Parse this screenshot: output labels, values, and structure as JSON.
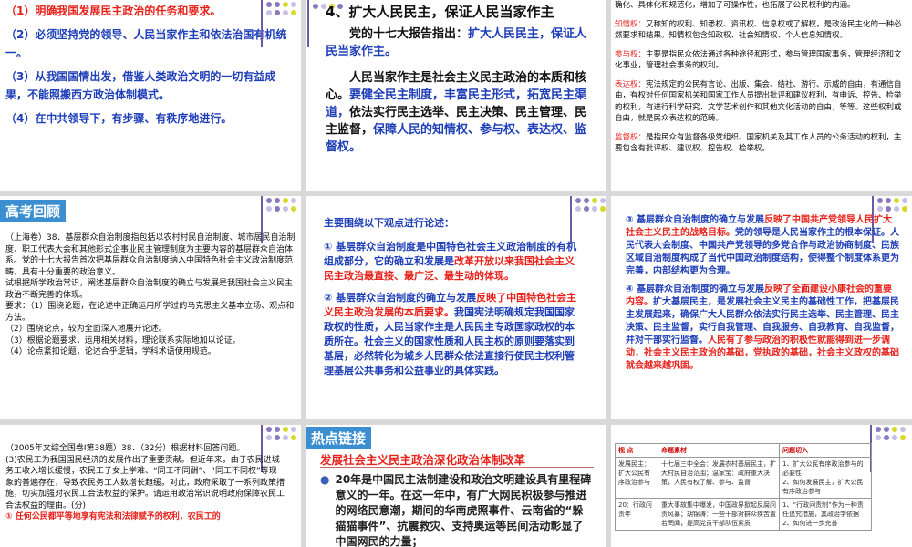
{
  "s1": {
    "items": [
      "（1）明确我国发展民主政治的任务和要求。",
      "（2）必须坚持党的领导、人民当家作主和依法治国有机统一。",
      "（3）从我国国情出发，借鉴人类政治文明的一切有益成果，不能照搬西方政治体制模式。",
      "（4）在中共领导下，有步骤、有秩序地进行。"
    ]
  },
  "s2": {
    "title": "4、扩大人民民主，保证人民当家作主",
    "p1_a": "党的十七大报告指出：",
    "p1_b": "扩大人民民主，保证人民当家作主。",
    "p2_a": "人民当家作主是社会主义民主政治的本质和核心。",
    "p2_b": "要健全民主制度，丰富民主形式，拓宽民主渠道，",
    "p2_c": "依法实行民主选举、民主决策、民主管理、民主监督，",
    "p2_d": "保障人民的知情权、参与权、表达权、监督权。"
  },
  "s3": {
    "intro": "确化、具体化和规范化，增加了可操作性，也拓展了公民权利的内涵。",
    "items": [
      {
        "term": "知情权：",
        "text": "又称知的权利、知悉权、资讯权、信息权或了解权，是政治民主化的一种必然要求和结果。知情权包含知政权、社会知情权、个人信息知情权。"
      },
      {
        "term": "参与权：",
        "text": "主要是指民众依法通过各种途径和形式，参与管理国家事务，管理经济和文化事业，管理社会事务的权利。"
      },
      {
        "term": "表达权：",
        "text": "宪法规定的公民有言论、出版、集会、结社、游行、示威的自由，有通信自由，有权对任何国家机关和国家工作人员提出批评和建议权利，有申诉、控告、检举的权利，有进行科学研究、文学艺术创作和其他文化活动的自由，等等。这些权利或自由，就是民众表达权的范畴。"
      },
      {
        "term": "监督权：",
        "text": "是指民众有监督各级党组织、国家机关及其工作人员的公务活动的权利，主要包含有批评权、建议权、控告权、检举权。"
      }
    ]
  },
  "s4": {
    "tag": "高考回顾",
    "body": "（上海卷）38．基层群众自治制度指包括以农村村民自治制度、城市居民自治制度、职工代表大会和其他形式企事业民主管理制度为主要内容的基层群众自治体系。党的十七大报告首次把基层群众自治制度纳入中国特色社会主义政治制度范畴，具有十分重要的政治意义。",
    "task": "试根据所学政治常识，阐述基层群众自治制度的确立与发展是我国社会主义民主政治不断完善的体现。",
    "req": [
      "要求：（1）围绕论题，在论述中正确运用所学过的马克思主义基本立场、观点和方法。",
      "（2）围绕论点，较为全面深入地展开论述。",
      "（3）根据论题要求，运用相关材料，理论联系实际地加以论证。",
      "（4）论点紧扣论题，论述合乎逻辑，学科术语使用规范。"
    ]
  },
  "s5": {
    "heading": "主要围绕以下观点进行论述：",
    "p1_a": "① 基层群众自治制度是中国特色社会主义政治制度的有机组成部分，它的确立和发展是",
    "p1_b": "改革开放以来我国社会主义民主政治最直接、最广泛、最生动的体现。",
    "p2_a": "② 基层群众自治制度的确立与发展",
    "p2_b": "反映了中国特色社会主义民主政治发展的本质要求。",
    "p2_c": "我国宪法明确规定我国国家政权的性质，人民当家作主是人民民主专政国家政权的本质所在。社会主义的国家性质和人民主权的原则要落实到基层，必然转化为城乡人民群众依法直接行使民主权利管理基层公共事务和公益事业的具体实践。"
  },
  "s6": {
    "p3_a": "③ 基层群众自治制度的确立与发展",
    "p3_b": "反映了中国共产党领导人民扩大社会主义民主的战略目标。",
    "p3_c": "党的领导是人民当家作主的根本保证。人民代表大会制度、中国共产党领导的多党合作与政治协商制度、民族区域自治制度构成了当代中国政治制度结构，使得整个制度体系更为完善，内部结构更为合理。",
    "p4_a": "④ 基层群众自治制度的确立与发展",
    "p4_b": "反映了全面建设小康社会的重要内容。",
    "p4_c": "扩大基层民主，是发展社会主义民主的基础性工作，把基层民主发展起来，确保广大人民群众依法实行民主选举、民主管理、民主决策、民主监督，实行自我管理、自我服务、自我教育、自我监督，并对干部实行监督。",
    "p4_d": "人民有了参与政治的积极性就能得到进一步调动，社会主义民主政治的基础，党执政的基础，社会主义政权的基础就会越来越巩固。"
  },
  "s7": {
    "head": "（2005年文综全国卷Ⅰ第38题）38．（32分）根据材料回答问题。",
    "body": "(3)农民工为我国国民经济的发展作出了重要贡献。但近年来，由于农民进城务工收入增长缓慢，农民工子女上学难、“同工不同酬”、“同工不同权”等现象的普遍存在，导致农民务工人数增长趋缓。对此，政府采取了一系列政策措施，切实加强对农民工合法权益的保护。请运用政治常识说明政府保障农民工合法权益的理由。(分)",
    "ans": "① 任何公民都平等地享有宪法和法律赋予的权利，农民工的"
  },
  "s8": {
    "tag": "热点链接",
    "subtitle": "发展社会主义民主政治深化政治体制改革",
    "bullet": "●",
    "body": "20年是中国民主法制建设和政治文明建设具有里程碑意义的一年。在这一年中，有广大网民积极参与推进的网络民意潮，期间的华南虎照事件、云南省的“躲猫猫事件”、抗震救灾、支持奥运等民间活动彰显了中国网民的力量；"
  },
  "s9": {
    "headers": [
      "视 点",
      "命题素材",
      "问题切入"
    ],
    "rows": [
      [
        "发展民主：扩大公民有序政治参与",
        "十七届三中全会：发展农村基层民主，扩大村民自治范围；温家宝：政府重大决策，人民有权了解、参与、监督",
        "1、扩大公民有序政治参与的必要性\n2、如何发展民主，扩大公民有序政治参与"
      ],
      [
        "20：行政问责年",
        "重大事故集中爆发，中国政界掀起反腐问责风暴；胡锦涛：一些干部对群众疾苦置若罔闻，提高党员干部队伍素质",
        "1、“行政问责制”作为一种责任追究措施，其政治学依据\n2、如何进一步完善"
      ]
    ]
  },
  "colors": {
    "dot_purple": "#8a78c0",
    "dot_lavender": "#c8bfe7",
    "dot_yellow": "#d8d82a",
    "tag_blue": "#3b8fd1"
  }
}
